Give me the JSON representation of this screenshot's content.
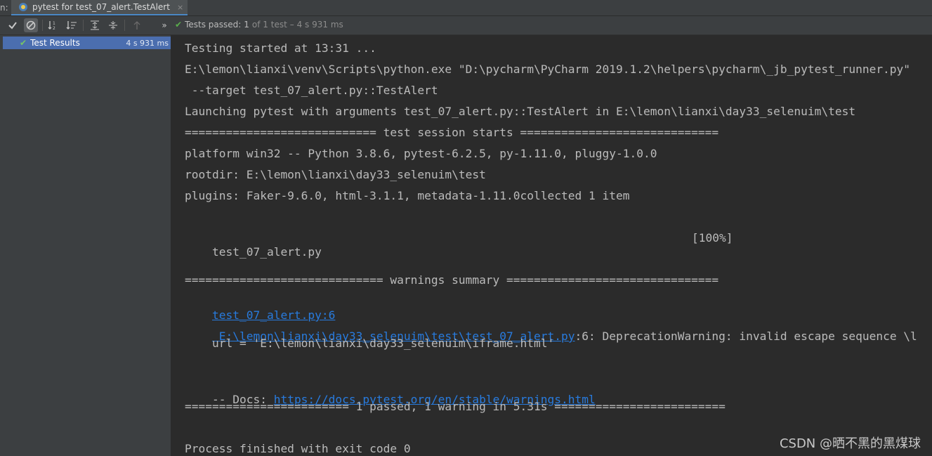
{
  "tab": {
    "prefix": "n:",
    "title": "pytest for test_07_alert.TestAlert",
    "close": "×"
  },
  "toolbar": {
    "status_label": "Tests passed:",
    "status_count": "1",
    "status_rest": "of 1 test",
    "status_time": "– 4 s 931 ms",
    "more": "»"
  },
  "tree": {
    "item_label": "Test Results",
    "item_time": "4 s 931 ms"
  },
  "console": {
    "l1": "Testing started at 13:31 ...",
    "l2": "E:\\lemon\\lianxi\\venv\\Scripts\\python.exe \"D:\\pycharm\\PyCharm 2019.1.2\\helpers\\pycharm\\_jb_pytest_runner.py\"",
    "l3": " --target test_07_alert.py::TestAlert",
    "l4": "Launching pytest with arguments test_07_alert.py::TestAlert in E:\\lemon\\lianxi\\day33_selenuim\\test",
    "l5": "============================ test session starts =============================",
    "l6": "platform win32 -- Python 3.8.6, pytest-6.2.5, py-1.11.0, pluggy-1.0.0",
    "l7": "rootdir: E:\\lemon\\lianxi\\day33_selenuim\\test",
    "l8": "plugins: Faker-9.6.0, html-3.1.1, metadata-1.11.0collected 1 item",
    "l9_file": "test_07_alert.py",
    "l9_pct": "[100%]",
    "l10": "============================= warnings summary ===============================",
    "l11_link": "test_07_alert.py:6",
    "l12_link": "E:\\lemon\\lianxi\\day33_selenuim\\test\\test_07_alert.py",
    "l12_rest": ":6: DeprecationWarning: invalid escape sequence \\l",
    "l13": "    url = 'E:\\lemon\\lianxi\\day33_selenuim\\iframe.html'",
    "l14_prefix": "-- Docs: ",
    "l14_link": "https://docs.pytest.org/en/stable/warnings.html",
    "l15": "======================== 1 passed, 1 warning in 5.31s =========================",
    "l16": "Process finished with exit code 0"
  },
  "watermark": "CSDN @晒不黑的黑煤球",
  "colors": {
    "background": "#2b2b2b",
    "panel": "#3c3f41",
    "selection": "#4b6eaf",
    "pass_green": "#5aaf4c",
    "link_blue": "#287bde"
  }
}
